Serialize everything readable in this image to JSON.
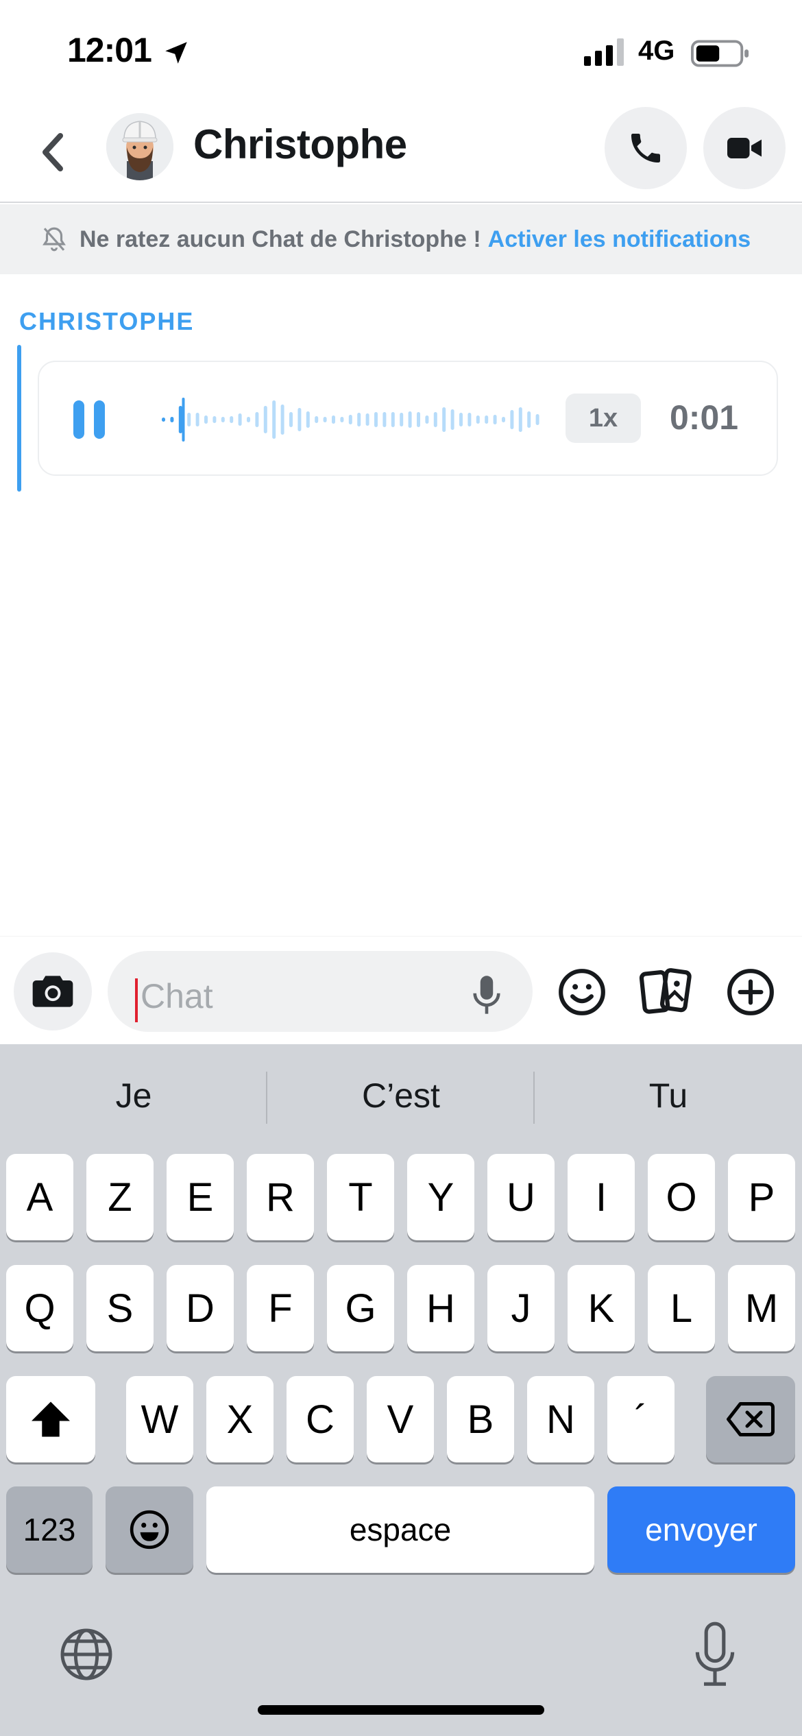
{
  "status_bar": {
    "time": "12:01",
    "network": "4G",
    "battery_level": 0.55
  },
  "header": {
    "contact_name": "Christophe"
  },
  "notification_banner": {
    "text": "Ne ratez aucun Chat de Christophe !",
    "link": "Activer les notifications"
  },
  "conversation": {
    "sender": "CHRISTOPHE",
    "voice_note": {
      "speed": "1x",
      "duration": "0:01",
      "progress": 0.06
    }
  },
  "input": {
    "placeholder": "Chat"
  },
  "keyboard": {
    "suggestions": [
      "Je",
      "C’est",
      "Tu"
    ],
    "row1": [
      "A",
      "Z",
      "E",
      "R",
      "T",
      "Y",
      "U",
      "I",
      "O",
      "P"
    ],
    "row2": [
      "Q",
      "S",
      "D",
      "F",
      "G",
      "H",
      "J",
      "K",
      "L",
      "M"
    ],
    "row3": [
      "W",
      "X",
      "C",
      "V",
      "B",
      "N",
      "´"
    ],
    "numbers_key": "123",
    "space_key": "espace",
    "send_key": "envoyer"
  },
  "icons": {
    "status": [
      "location-arrow-icon",
      "signal-icon",
      "battery-icon"
    ],
    "header": [
      "back-chevron-icon",
      "phone-icon",
      "video-camera-icon"
    ],
    "banner": [
      "bell-muted-icon"
    ],
    "input": [
      "camera-icon",
      "microphone-icon",
      "smiley-icon",
      "sticker-cards-icon",
      "plus-circle-icon"
    ],
    "keyboard": [
      "shift-icon",
      "backspace-icon",
      "emoji-icon",
      "globe-icon",
      "dictation-mic-icon"
    ]
  },
  "colors": {
    "accent": "#3e9ff0",
    "send_key": "#2f7cf6",
    "keyboard_bg": "#d1d4d9",
    "caret": "#e0202f"
  }
}
